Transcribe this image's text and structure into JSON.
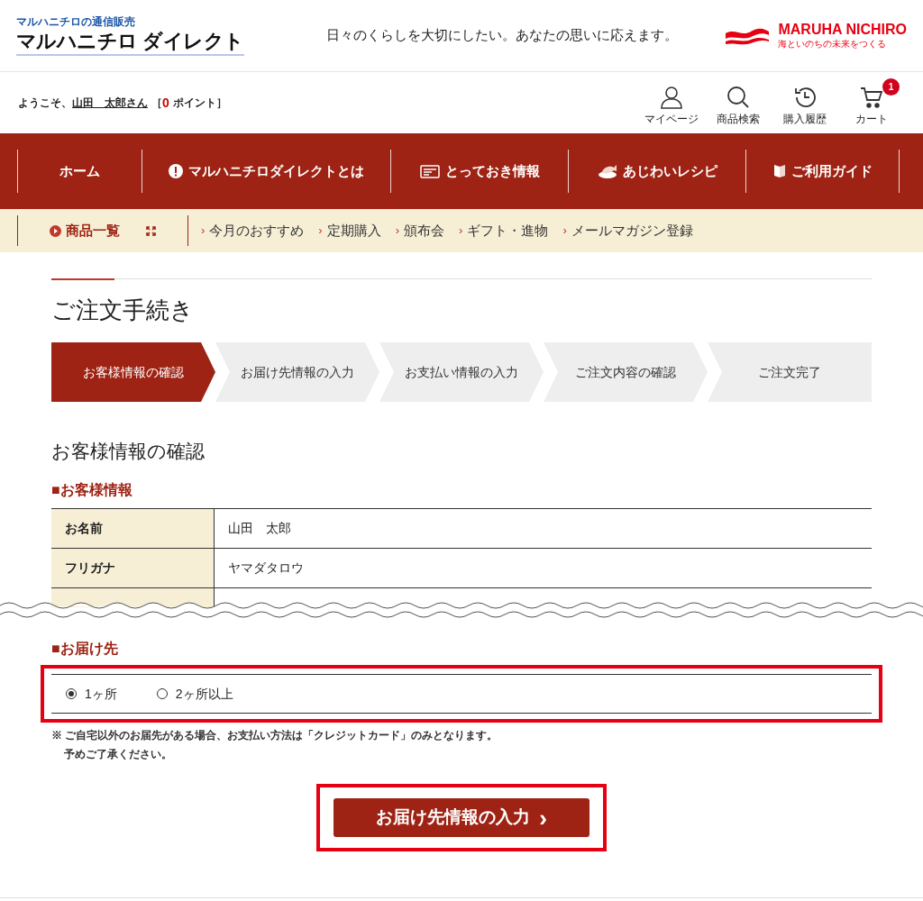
{
  "header": {
    "brand_sub": "マルハニチロの通信販売",
    "brand": "マルハニチロ ダイレクト",
    "tagline": "日々のくらしを大切にしたい。あなたの思いに応えます。",
    "corp_name": "MARUHA NICHIRO",
    "corp_slogan": "海といのちの未来をつくる"
  },
  "welcome": {
    "prefix": "ようこそ、",
    "user": "山田　太郎さん",
    "open": "［",
    "points": "0",
    "points_unit": "ポイント］"
  },
  "utility": [
    {
      "kind": "user",
      "label": "マイページ"
    },
    {
      "kind": "search",
      "label": "商品検索"
    },
    {
      "kind": "history",
      "label": "購入履歴"
    },
    {
      "kind": "cart",
      "label": "カート",
      "badge": "1"
    }
  ],
  "main_nav": [
    {
      "kind": "none",
      "label": "ホーム"
    },
    {
      "kind": "alert",
      "label": "マルハニチロダイレクトとは"
    },
    {
      "kind": "card",
      "label": "とっておき情報"
    },
    {
      "kind": "dish",
      "label": "あじわいレシピ"
    },
    {
      "kind": "book",
      "label": "ご利用ガイド"
    }
  ],
  "sub_nav": {
    "primary": "商品一覧",
    "links": [
      "今月のおすすめ",
      "定期購入",
      "頒布会",
      "ギフト・進物",
      "メールマガジン登録"
    ]
  },
  "page_title": "ご注文手続き",
  "steps": [
    {
      "label": "お客様情報の確認",
      "selected": true
    },
    {
      "label": "お届け先情報の入力",
      "selected": false
    },
    {
      "label": "お支払い情報の入力",
      "selected": false
    },
    {
      "label": "ご注文内容の確認",
      "selected": false
    },
    {
      "label": "ご注文完了",
      "selected": false
    }
  ],
  "section_title": "お客様情報の確認",
  "customer": {
    "heading": "■お客様情報",
    "rows": [
      {
        "label": "お名前",
        "value": "山田　太郎"
      },
      {
        "label": "フリガナ",
        "value": "ヤマダタロウ"
      }
    ]
  },
  "delivery": {
    "heading": "■お届け先",
    "options": [
      {
        "label": "1ヶ所",
        "selected": true
      },
      {
        "label": "2ヶ所以上",
        "selected": false
      }
    ],
    "note": [
      "※ ご自宅以外のお届先がある場合、お支払い方法は「クレジットカード」のみとなります。",
      "予めご了承ください。"
    ]
  },
  "next_button": {
    "label": "お届け先情報の入力",
    "icon": "›"
  }
}
